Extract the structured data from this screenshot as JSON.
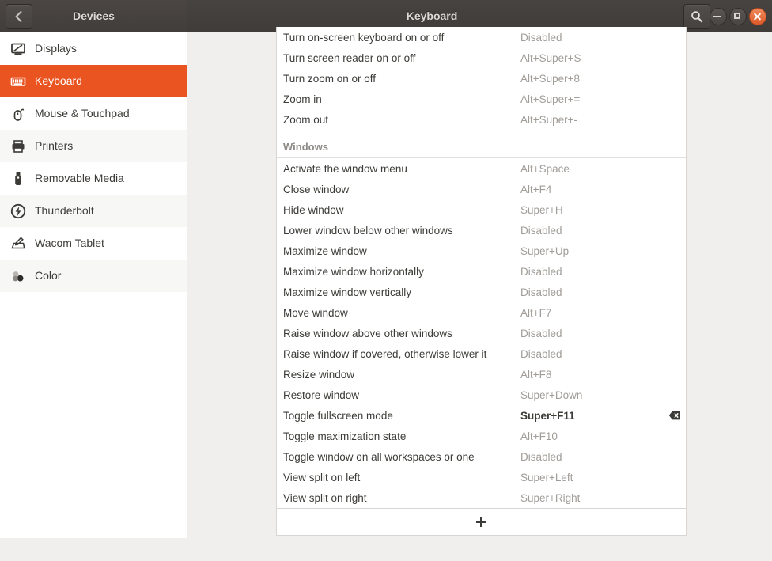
{
  "window": {
    "title": "Keyboard",
    "panel_title": "Devices",
    "back_icon": "chevron-left-icon",
    "search_icon": "search-icon",
    "minimize_label": "Minimize",
    "maximize_label": "Maximize",
    "close_label": "Close"
  },
  "theme": {
    "accent": "#e95420",
    "titlebar": "#474341",
    "sidebar_bg": "#ffffff",
    "content_bg": "#f0efee",
    "text": "#3c3b37",
    "muted": "#a09c98",
    "section_header": "#8e8b87"
  },
  "sidebar": {
    "items": [
      {
        "label": "Displays",
        "icon": "display-icon",
        "active": false
      },
      {
        "label": "Keyboard",
        "icon": "keyboard-icon",
        "active": true
      },
      {
        "label": "Mouse & Touchpad",
        "icon": "mouse-icon",
        "active": false
      },
      {
        "label": "Printers",
        "icon": "printer-icon",
        "active": false
      },
      {
        "label": "Removable Media",
        "icon": "usb-drive-icon",
        "active": false
      },
      {
        "label": "Thunderbolt",
        "icon": "thunderbolt-icon",
        "active": false
      },
      {
        "label": "Wacom Tablet",
        "icon": "wacom-tablet-icon",
        "active": false
      },
      {
        "label": "Color",
        "icon": "color-circles-icon",
        "active": false
      }
    ]
  },
  "shortcuts": {
    "add_button_label": "+",
    "add_button_icon": "plus-icon",
    "clear_icon": "backspace-clear-icon",
    "groups": [
      {
        "name": "",
        "show_header": false,
        "rows": [
          {
            "name": "Turn on-screen keyboard on or off",
            "accel": "Disabled",
            "edited": false
          },
          {
            "name": "Turn screen reader on or off",
            "accel": "Alt+Super+S",
            "edited": false
          },
          {
            "name": "Turn zoom on or off",
            "accel": "Alt+Super+8",
            "edited": false
          },
          {
            "name": "Zoom in",
            "accel": "Alt+Super+=",
            "edited": false
          },
          {
            "name": "Zoom out",
            "accel": "Alt+Super+-",
            "edited": false
          }
        ]
      },
      {
        "name": "Windows",
        "show_header": true,
        "rows": [
          {
            "name": "Activate the window menu",
            "accel": "Alt+Space",
            "edited": false
          },
          {
            "name": "Close window",
            "accel": "Alt+F4",
            "edited": false
          },
          {
            "name": "Hide window",
            "accel": "Super+H",
            "edited": false
          },
          {
            "name": "Lower window below other windows",
            "accel": "Disabled",
            "edited": false
          },
          {
            "name": "Maximize window",
            "accel": "Super+Up",
            "edited": false
          },
          {
            "name": "Maximize window horizontally",
            "accel": "Disabled",
            "edited": false
          },
          {
            "name": "Maximize window vertically",
            "accel": "Disabled",
            "edited": false
          },
          {
            "name": "Move window",
            "accel": "Alt+F7",
            "edited": false
          },
          {
            "name": "Raise window above other windows",
            "accel": "Disabled",
            "edited": false
          },
          {
            "name": "Raise window if covered, otherwise lower it",
            "accel": "Disabled",
            "edited": false
          },
          {
            "name": "Resize window",
            "accel": "Alt+F8",
            "edited": false
          },
          {
            "name": "Restore window",
            "accel": "Super+Down",
            "edited": false
          },
          {
            "name": "Toggle fullscreen mode",
            "accel": "Super+F11",
            "edited": true
          },
          {
            "name": "Toggle maximization state",
            "accel": "Alt+F10",
            "edited": false
          },
          {
            "name": "Toggle window on all workspaces or one",
            "accel": "Disabled",
            "edited": false
          },
          {
            "name": "View split on left",
            "accel": "Super+Left",
            "edited": false
          },
          {
            "name": "View split on right",
            "accel": "Super+Right",
            "edited": false
          }
        ]
      }
    ]
  }
}
